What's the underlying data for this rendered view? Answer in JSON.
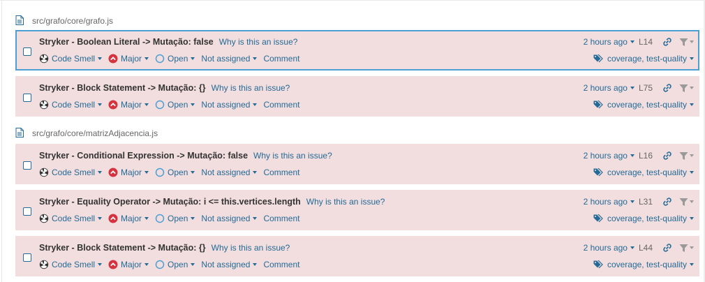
{
  "files": [
    {
      "path": "src/grafo/core/grafo.js",
      "issues": [
        {
          "message": "Stryker - Boolean Literal -> Mutação: false",
          "why": "Why is this an issue?",
          "type": "Code Smell",
          "severity": "Major",
          "status": "Open",
          "assignee": "Not assigned",
          "comment": "Comment",
          "date": "2 hours ago",
          "line": "L14",
          "tags": "coverage, test-quality",
          "selected": true
        },
        {
          "message": "Stryker - Block Statement -> Mutação: {}",
          "why": "Why is this an issue?",
          "type": "Code Smell",
          "severity": "Major",
          "status": "Open",
          "assignee": "Not assigned",
          "comment": "Comment",
          "date": "2 hours ago",
          "line": "L75",
          "tags": "coverage, test-quality",
          "selected": false
        }
      ]
    },
    {
      "path": "src/grafo/core/matrizAdjacencia.js",
      "issues": [
        {
          "message": "Stryker - Conditional Expression -> Mutação: false",
          "why": "Why is this an issue?",
          "type": "Code Smell",
          "severity": "Major",
          "status": "Open",
          "assignee": "Not assigned",
          "comment": "Comment",
          "date": "2 hours ago",
          "line": "L16",
          "tags": "coverage, test-quality",
          "selected": false
        },
        {
          "message": "Stryker - Equality Operator -> Mutação: i <= this.vertices.length",
          "why": "Why is this an issue?",
          "type": "Code Smell",
          "severity": "Major",
          "status": "Open",
          "assignee": "Not assigned",
          "comment": "Comment",
          "date": "2 hours ago",
          "line": "L31",
          "tags": "coverage, test-quality",
          "selected": false
        },
        {
          "message": "Stryker - Block Statement -> Mutação: {}",
          "why": "Why is this an issue?",
          "type": "Code Smell",
          "severity": "Major",
          "status": "Open",
          "assignee": "Not assigned",
          "comment": "Comment",
          "date": "2 hours ago",
          "line": "L44",
          "tags": "coverage, test-quality",
          "selected": false
        }
      ]
    }
  ],
  "icons": {
    "file": "file-icon",
    "type": "code-smell-icon",
    "severity": "major-severity-icon",
    "status": "open-status-icon",
    "link": "link-icon",
    "filter": "filter-icon",
    "tags": "tags-icon"
  },
  "colors": {
    "issue_background": "#f2dede",
    "link": "#236a97",
    "selected_border": "#4b9fd5",
    "major": "#d4333f"
  }
}
